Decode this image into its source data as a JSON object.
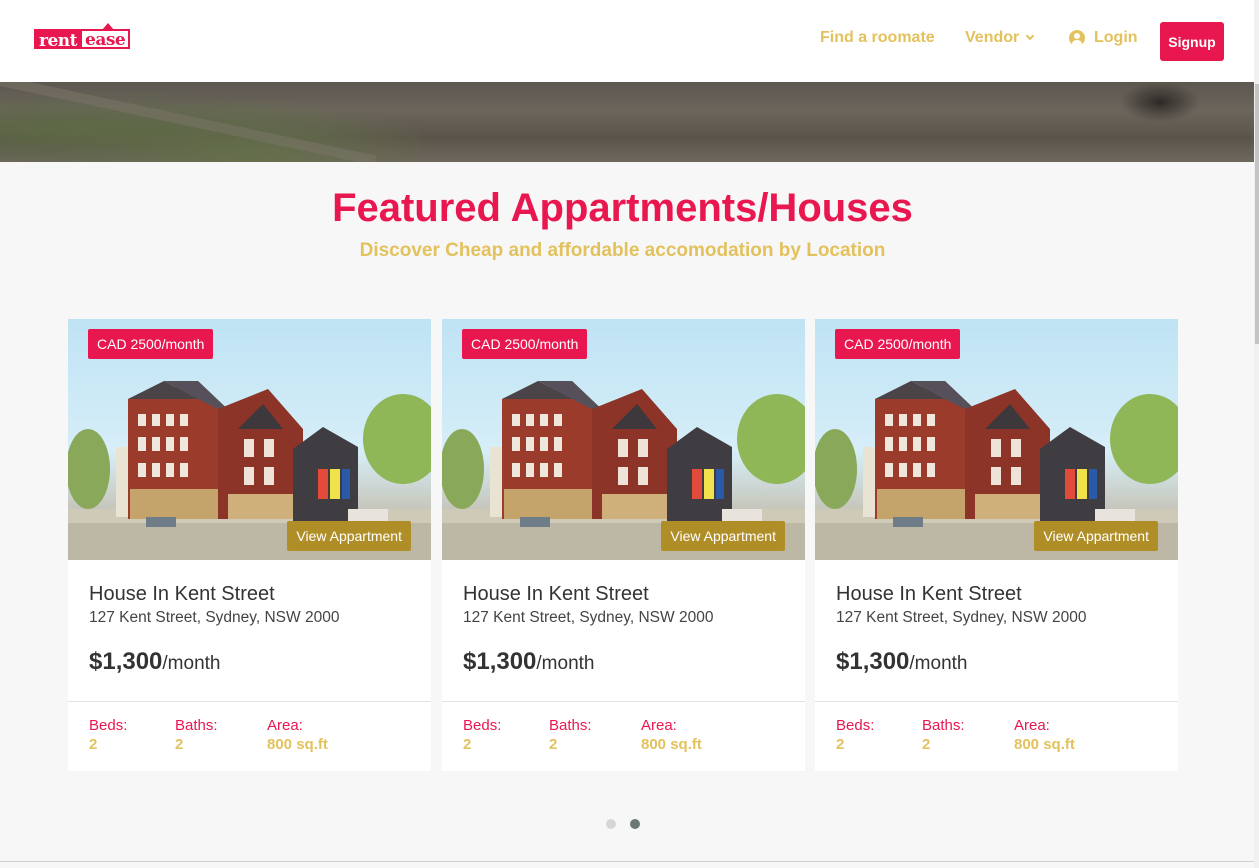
{
  "header": {
    "logo_rent": "rent",
    "logo_ease": "ease",
    "nav": {
      "roommate": "Find a roomate",
      "vendor": "Vendor",
      "login": "Login",
      "signup": "Signup"
    }
  },
  "section": {
    "title": "Featured Appartments/Houses",
    "subtitle": "Discover Cheap and affordable accomodation by Location"
  },
  "cards": [
    {
      "badge": "CAD 2500/month",
      "view_label": "View Appartment",
      "title": "House In Kent Street",
      "address": "127 Kent Street, Sydney, NSW 2000",
      "price": "$1,300",
      "price_unit": "/month",
      "beds_label": "Beds:",
      "beds": "2",
      "baths_label": "Baths:",
      "baths": "2",
      "area_label": "Area:",
      "area": "800 sq.ft"
    },
    {
      "badge": "CAD 2500/month",
      "view_label": "View Appartment",
      "title": "House In Kent Street",
      "address": "127 Kent Street, Sydney, NSW 2000",
      "price": "$1,300",
      "price_unit": "/month",
      "beds_label": "Beds:",
      "beds": "2",
      "baths_label": "Baths:",
      "baths": "2",
      "area_label": "Area:",
      "area": "800 sq.ft"
    },
    {
      "badge": "CAD 2500/month",
      "view_label": "View Appartment",
      "title": "House In Kent Street",
      "address": "127 Kent Street, Sydney, NSW 2000",
      "price": "$1,300",
      "price_unit": "/month",
      "beds_label": "Beds:",
      "beds": "2",
      "baths_label": "Baths:",
      "baths": "2",
      "area_label": "Area:",
      "area": "800 sq.ft"
    }
  ],
  "carousel": {
    "pages": 2,
    "active_page": 2
  },
  "colors": {
    "brand": "#e8174f",
    "accent": "#e3c25d",
    "view_button": "#b08e27"
  }
}
